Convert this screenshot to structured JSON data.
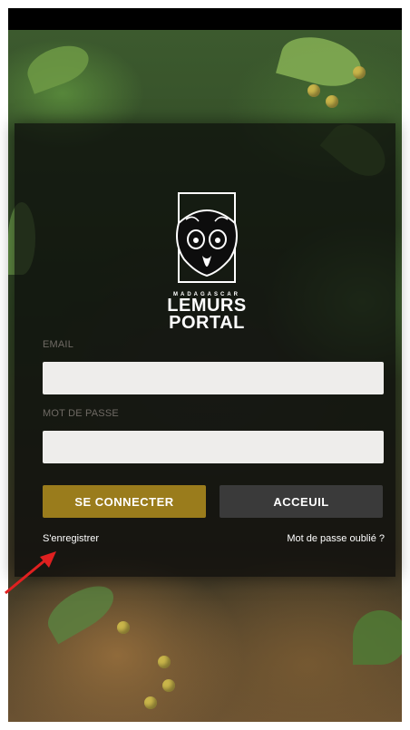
{
  "logo": {
    "kicker": "MADAGASCAR",
    "title_line1": "LEMURS",
    "title_line2": "PORTAL"
  },
  "form": {
    "email_label": "EMAIL",
    "email_value": "",
    "password_label": "MOT DE PASSE",
    "password_value": ""
  },
  "buttons": {
    "login": "SE CONNECTER",
    "home": "ACCEUIL"
  },
  "links": {
    "register": "S'enregistrer",
    "forgot_password": "Mot de passe oublié ?"
  },
  "colors": {
    "accent": "#9a7c1c",
    "secondary_button": "#3a3a3a",
    "annotation_arrow": "#e02020"
  }
}
